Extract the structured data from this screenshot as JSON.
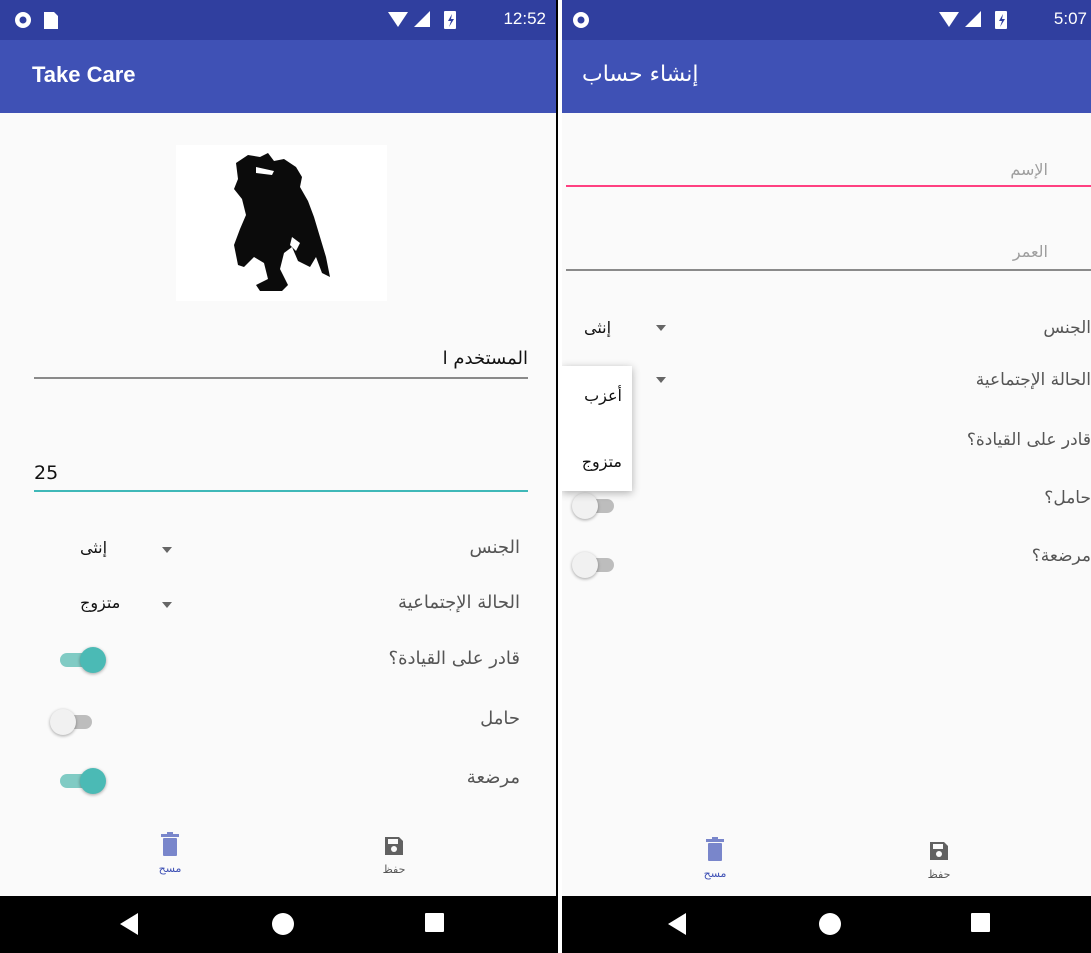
{
  "left": {
    "status_time": "12:52",
    "app_title": "Take Care",
    "name_value": "المستخدم ا",
    "age_value": "25",
    "gender_label": "الجنس",
    "gender_value": "إنثى",
    "marital_label": "الحالة الإجتماعية",
    "marital_value": "متزوج",
    "driving_label": "قادر على القيادة؟",
    "driving_on": true,
    "pregnant_label": "حامل",
    "pregnant_on": false,
    "nursing_label": "مرضعة",
    "nursing_on": true,
    "nav_clear_label": "مسح",
    "nav_save_label": "حفظ"
  },
  "right": {
    "status_time": "5:07",
    "app_title": "إنشاء حساب",
    "name_placeholder": "الإسم",
    "age_placeholder": "العمر",
    "gender_label": "الجنس",
    "gender_value": "إنثى",
    "marital_label": "الحالة الإجتماعية",
    "driving_label": "قادر على القيادة؟",
    "pregnant_label": "حامل؟",
    "nursing_label": "مرضعة؟",
    "dropdown_options": [
      "أعزب",
      "متزوج"
    ],
    "nav_clear_label": "مسح",
    "nav_save_label": "حفظ"
  },
  "colors": {
    "primary": "#3f51b5",
    "primary_dark": "#303f9f",
    "accent_teal": "#4bbab5",
    "accent_pink": "#ff4081",
    "nav_active": "#3f51b5",
    "nav_inactive": "#757575"
  },
  "icons": [
    "circle-status-icon",
    "sdcard-icon",
    "wifi-icon",
    "signal-icon",
    "battery-icon",
    "trash-icon",
    "save-icon",
    "back-icon",
    "home-icon",
    "recents-icon",
    "profile-silhouette-image"
  ]
}
